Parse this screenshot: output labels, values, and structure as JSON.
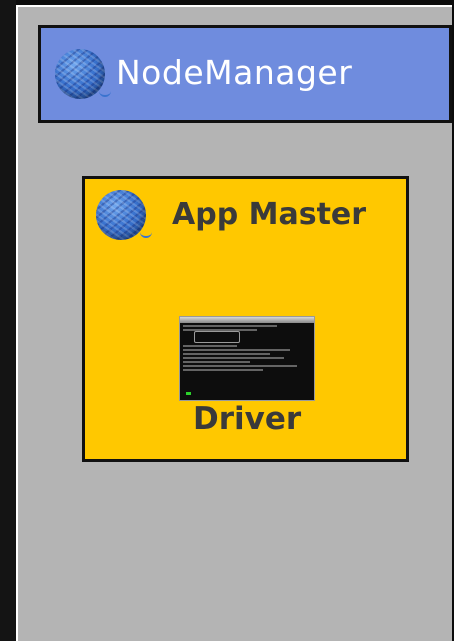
{
  "node_manager": {
    "title": "NodeManager",
    "icon": "yarn-ball-icon",
    "color": "#6f8cde"
  },
  "app_master": {
    "title": "App Master",
    "icon": "yarn-ball-icon",
    "color": "#ffc800"
  },
  "driver": {
    "label": "Driver",
    "icon": "terminal-icon"
  },
  "colors": {
    "background": "#b4b4b4",
    "border": "#111111"
  }
}
